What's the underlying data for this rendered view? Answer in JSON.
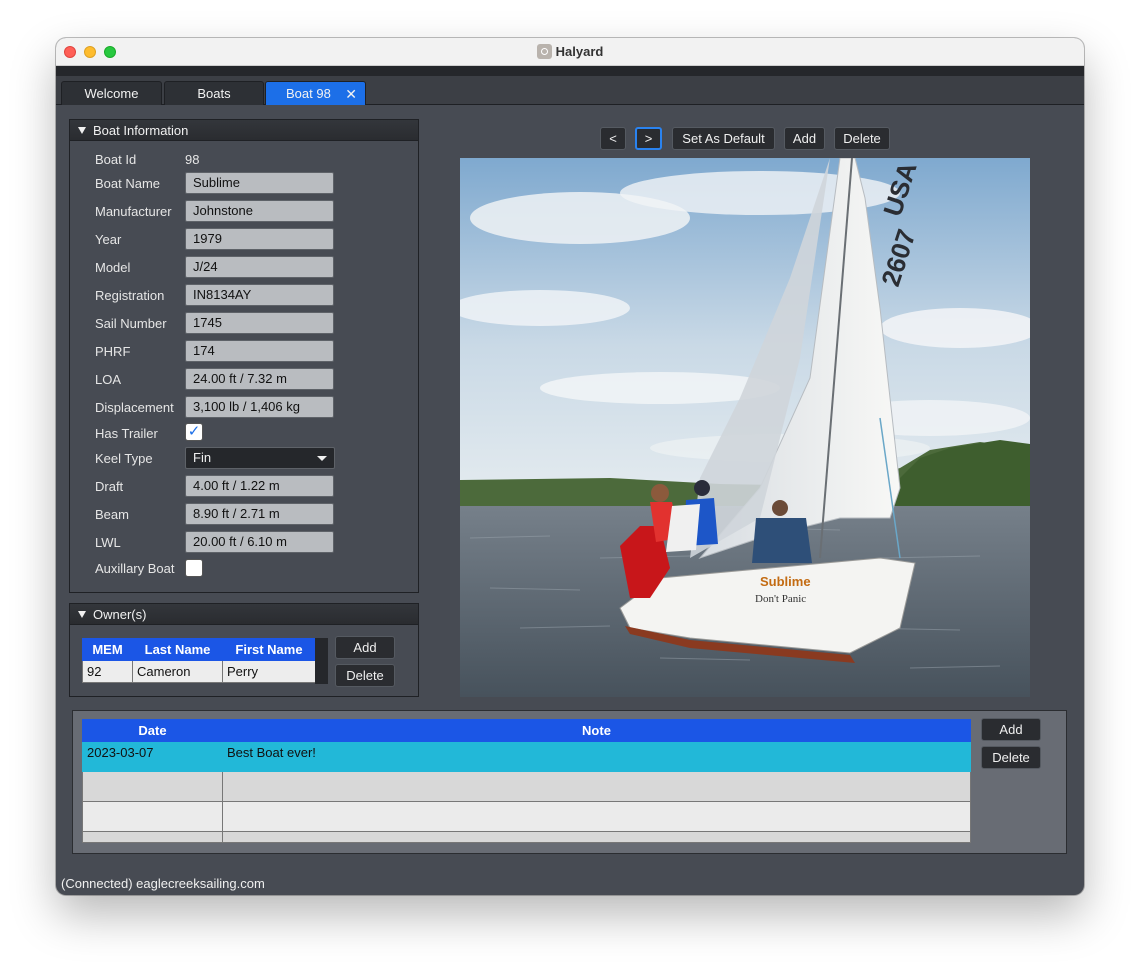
{
  "window": {
    "title": "Halyard"
  },
  "tabs": [
    {
      "label": "Welcome"
    },
    {
      "label": "Boats"
    },
    {
      "label": "Boat 98",
      "close": "✕"
    }
  ],
  "boat_info": {
    "header": "Boat Information",
    "fields": {
      "boat_id": {
        "label": "Boat Id",
        "value": "98"
      },
      "boat_name": {
        "label": "Boat Name",
        "value": "Sublime"
      },
      "manufacturer": {
        "label": "Manufacturer",
        "value": "Johnstone"
      },
      "year": {
        "label": "Year",
        "value": "1979"
      },
      "model": {
        "label": "Model",
        "value": "J/24"
      },
      "registration": {
        "label": "Registration",
        "value": "IN8134AY"
      },
      "sail_number": {
        "label": "Sail Number",
        "value": "1745"
      },
      "phrf": {
        "label": "PHRF",
        "value": "174"
      },
      "loa": {
        "label": "LOA",
        "value": "24.00 ft / 7.32 m"
      },
      "displacement": {
        "label": "Displacement",
        "value": "3,100 lb / 1,406 kg"
      },
      "has_trailer": {
        "label": "Has Trailer",
        "checked": true,
        "mark": "✓"
      },
      "keel_type": {
        "label": "Keel Type",
        "value": "Fin"
      },
      "draft": {
        "label": "Draft",
        "value": "4.00 ft / 1.22 m"
      },
      "beam": {
        "label": "Beam",
        "value": "8.90 ft / 2.71 m"
      },
      "lwl": {
        "label": "LWL",
        "value": "20.00 ft / 6.10 m"
      },
      "auxiliary_boat": {
        "label": "Auxillary Boat",
        "checked": false,
        "mark": ""
      }
    }
  },
  "owners": {
    "header": "Owner(s)",
    "columns": [
      "MEM",
      "Last Name",
      "First Name"
    ],
    "rows": [
      [
        "92",
        "Cameron",
        "Perry"
      ]
    ],
    "add_label": "Add",
    "delete_label": "Delete"
  },
  "image_toolbar": {
    "prev": "<",
    "next": ">",
    "set_default": "Set As Default",
    "add": "Add",
    "delete": "Delete"
  },
  "photo": {
    "hull_name": "Sublime",
    "hull_subtext": "Don't Panic",
    "sail_letters": "USA",
    "sail_number": "2607"
  },
  "notes": {
    "columns": [
      "Date",
      "Note"
    ],
    "rows": [
      [
        "2023-03-07",
        "Best Boat ever!"
      ]
    ],
    "add_label": "Add",
    "delete_label": "Delete"
  },
  "status": "(Connected) eaglecreeksailing.com",
  "colors": {
    "accent": "#1c6fe8",
    "header_blue": "#1b56e6",
    "selected_row": "#22b8d8",
    "window_bg": "#474b53"
  }
}
